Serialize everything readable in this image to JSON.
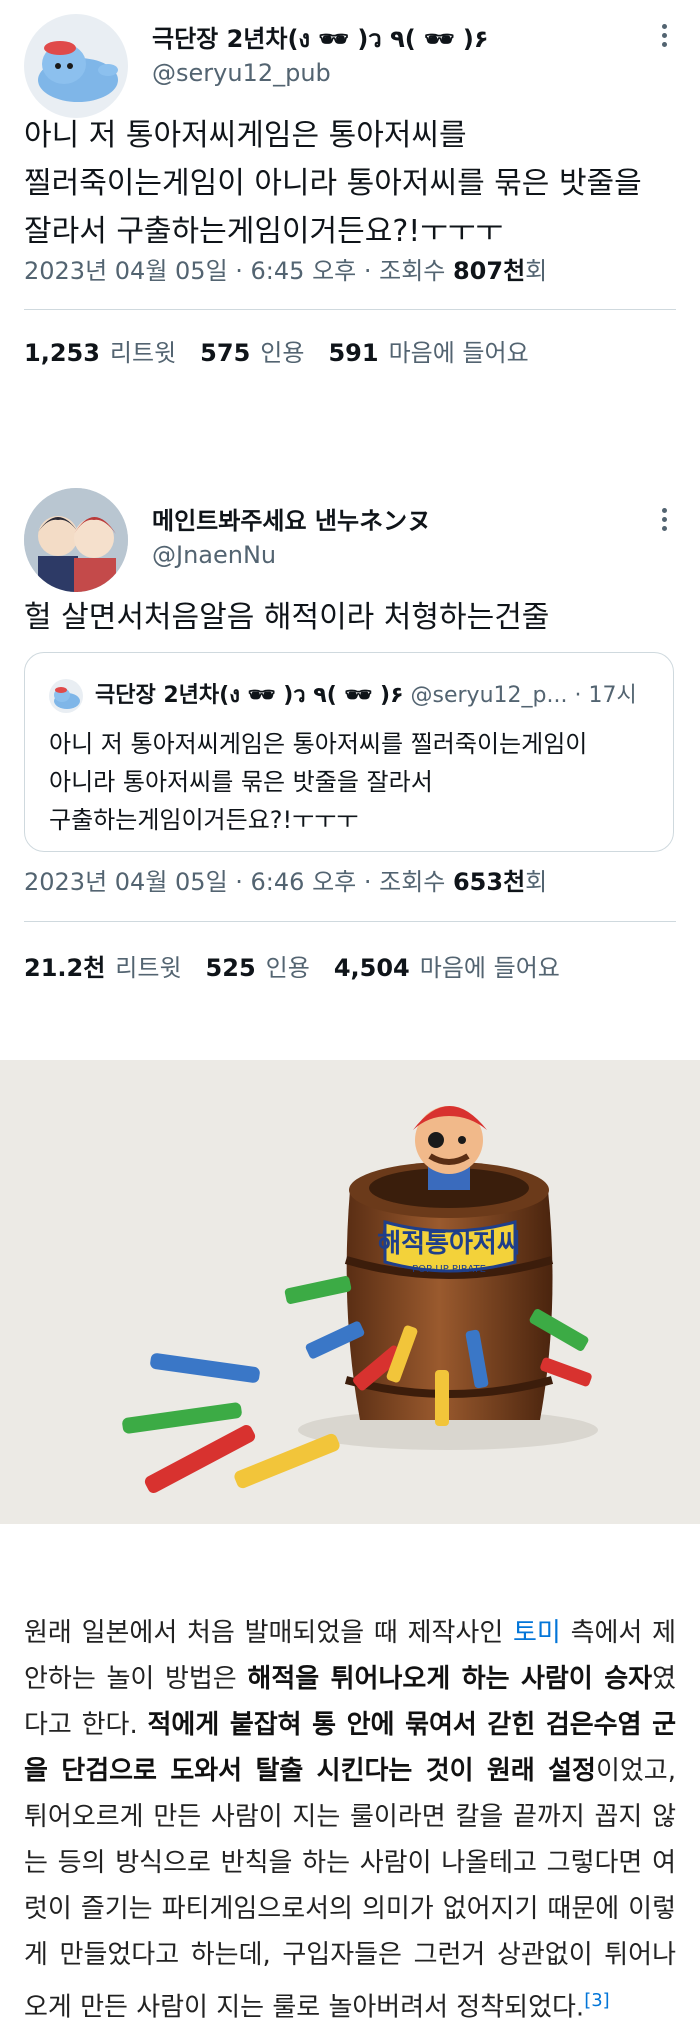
{
  "tweet1": {
    "name": "극단장 2년차(ง 🕶 )ว ٩( 🕶 )۶",
    "handle": "@seryu12_pub",
    "text": "아니 저 통아저씨게임은 통아저씨를\n찔러죽이는게임이 아니라 통아저씨를 묶은 밧줄을\n잘라서 구출하는게임이거든요?!ㅜㅜㅜ",
    "meta_prefix": "2023년 04월 05일 · 6:45 오후 · 조회수 ",
    "views": "807천",
    "meta_suffix": "회",
    "retweets": "1,253",
    "retweets_label": "리트윗",
    "quotes": "575",
    "quotes_label": "인용",
    "likes": "591",
    "likes_label": "마음에 들어요"
  },
  "tweet2": {
    "name": "메인트봐주세요 낸누ネンヌ",
    "handle": "@JnaenNu",
    "text": "헐 살면서처음알음 해적이라 처형하는건줄",
    "quote": {
      "name": "극단장 2년차(ง 🕶 )ว ٩( 🕶 )۶",
      "handle": "@seryu12_p...",
      "time": "· 17시",
      "text": "아니 저 통아저씨게임은 통아저씨를 찔러죽이는게임이\n아니라 통아저씨를 묶은 밧줄을 잘라서\n구출하는게임이거든요?!ㅜㅜㅜ"
    },
    "meta_prefix": "2023년 04월 05일 · 6:46 오후 · 조회수 ",
    "views": "653천",
    "meta_suffix": "회",
    "retweets": "21.2천",
    "retweets_label": "리트윗",
    "quotes": "525",
    "quotes_label": "인용",
    "likes": "4,504",
    "likes_label": "마음에 들어요"
  },
  "photo": {
    "barrel_label": "해적통아저씨",
    "barrel_sublabel": "POP-UP PIRATE"
  },
  "article": {
    "p1": "원래 일본에서 처음 발매되었을 때 제작사인 ",
    "link": "토미",
    "p2": " 측에서 제안하는 놀이 방법은 ",
    "bold1": "해적을 튀어나오게 하는 사람이 승자",
    "p3": "였다고 한다. ",
    "bold2": "적에게 붙잡혀 통 안에 묶여서 갇힌 검은수염 군을 단검으로 도와서 탈출 시킨다는 것이 원래 설정",
    "p4": "이었고, 튀어오르게 만든 사람이 지는 룰이라면 칼을 끝까지 꼽지 않는 등의 방식으로 반칙을 하는 사람이 나올테고 그렇다면 여럿이 즐기는 파티게임으로서의 의미가 없어지기 때문에 이렇게 만들었다고 하는데, 구입자들은 그런거 상관없이 튀어나오게 만든 사람이 지는 룰로 놀아버려서 정착되었다.",
    "ref": "[3]"
  }
}
